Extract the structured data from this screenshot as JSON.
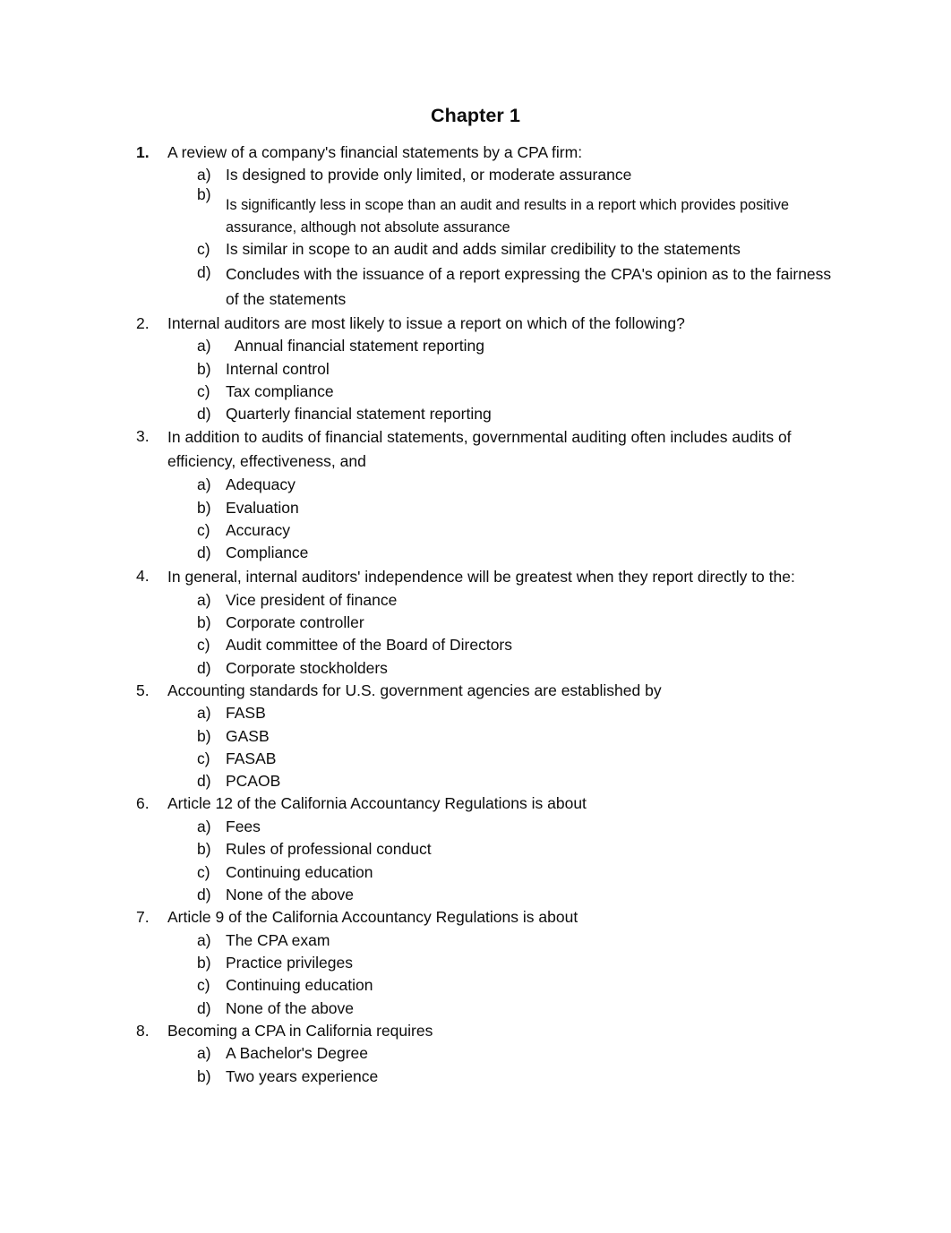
{
  "document": {
    "title": "Chapter 1"
  },
  "questions": [
    {
      "number": "1.",
      "stem": "A review of a company's financial statements by a CPA firm:",
      "options": [
        {
          "letter": "a)",
          "text": "Is designed to provide only limited, or moderate assurance"
        },
        {
          "letter": "b)",
          "text": "Is significantly less in scope than an audit and results in a report which provides positive assurance, although not absolute assurance"
        },
        {
          "letter": "c)",
          "text": "Is similar in scope to an audit and adds similar credibility to the statements"
        },
        {
          "letter": "d)",
          "text": "Concludes with the issuance of a report expressing the CPA's opinion as to the fairness of the statements"
        }
      ]
    },
    {
      "number": "2.",
      "stem": "Internal auditors are most likely to issue a report on which of the following?",
      "options": [
        {
          "letter": "a)",
          "text": "  Annual financial statement reporting"
        },
        {
          "letter": "b)",
          "text": "Internal control"
        },
        {
          "letter": "c)",
          "text": "Tax compliance"
        },
        {
          "letter": "d)",
          "text": "Quarterly financial statement reporting"
        }
      ]
    },
    {
      "number": "3.",
      "stem": "In addition to audits of financial statements, governmental auditing often includes audits of efficiency, effectiveness, and",
      "options": [
        {
          "letter": "a)",
          "text": "Adequacy"
        },
        {
          "letter": "b)",
          "text": "Evaluation"
        },
        {
          "letter": "c)",
          "text": "Accuracy"
        },
        {
          "letter": "d)",
          "text": "Compliance"
        }
      ]
    },
    {
      "number": "4.",
      "stem": "In general, internal auditors' independence will be greatest when they report directly to the:",
      "options": [
        {
          "letter": "a)",
          "text": "Vice president of finance"
        },
        {
          "letter": "b)",
          "text": "Corporate controller"
        },
        {
          "letter": "c)",
          "text": "Audit committee of the Board of Directors"
        },
        {
          "letter": "d)",
          "text": "Corporate stockholders"
        }
      ]
    },
    {
      "number": "5.",
      "stem": "Accounting standards for U.S. government agencies are established by",
      "options": [
        {
          "letter": "a)",
          "text": "FASB"
        },
        {
          "letter": "b)",
          "text": "GASB"
        },
        {
          "letter": "c)",
          "text": "FASAB"
        },
        {
          "letter": "d)",
          "text": "PCAOB"
        }
      ]
    },
    {
      "number": "6.",
      "stem": "Article 12 of the California Accountancy Regulations is about",
      "options": [
        {
          "letter": "a)",
          "text": "Fees"
        },
        {
          "letter": "b)",
          "text": "Rules of professional conduct"
        },
        {
          "letter": "c)",
          "text": "Continuing education"
        },
        {
          "letter": "d)",
          "text": "None of the above"
        }
      ]
    },
    {
      "number": "7.",
      "stem": "Article 9 of the California Accountancy Regulations is about",
      "options": [
        {
          "letter": "a)",
          "text": "The CPA exam"
        },
        {
          "letter": "b)",
          "text": "Practice privileges"
        },
        {
          "letter": "c)",
          "text": "Continuing education"
        },
        {
          "letter": "d)",
          "text": "None of the above"
        }
      ]
    },
    {
      "number": "8.",
      "stem": "Becoming a CPA in California requires",
      "options": [
        {
          "letter": "a)",
          "text": "A Bachelor's Degree"
        },
        {
          "letter": "b)",
          "text": "Two years experience"
        }
      ]
    }
  ]
}
